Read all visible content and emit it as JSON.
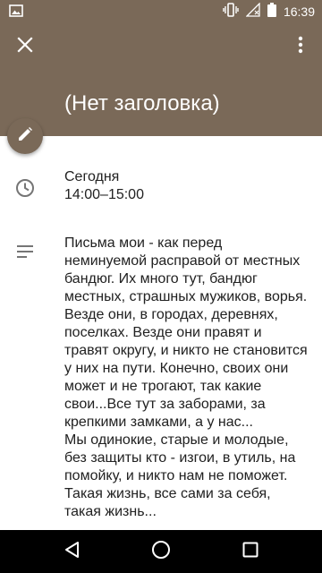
{
  "status_bar": {
    "time": "16:39"
  },
  "header": {
    "title": "(Нет заголовка)",
    "color": "#7a6958"
  },
  "event": {
    "date_label": "Сегодня",
    "time_range": "14:00–15:00",
    "description": "Письма мои - как перед неминуемой расправой от местных бандюг. Их много тут, бандюг местных, страшных мужиков, ворья. Везде они, в городах, деревнях, поселках. Везде они правят и травят округу, и никто не становится у них на пути. Конечно, своих они может и не трогают, так какие свои...Все тут за заборами, за крепкими замками, а у нас...\nМы одинокие, старые и молодые, без защиты кто - изгои, в утиль, на помойку, и никто нам не поможет. Такая жизнь, все сами за себя, такая жизнь..."
  },
  "icons": {
    "close": "close-icon",
    "more": "more-vert-icon",
    "edit": "edit-pencil-icon",
    "time": "clock-icon",
    "description": "notes-icon",
    "nav_back": "back-triangle-icon",
    "nav_home": "home-circle-icon",
    "nav_recents": "recents-square-icon"
  }
}
